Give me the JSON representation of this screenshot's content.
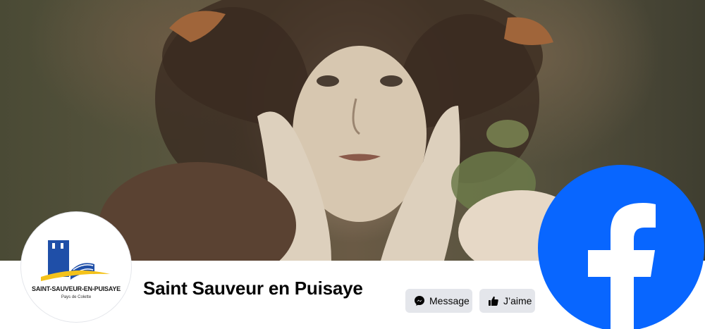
{
  "cover": {
    "icon": "cover-photo"
  },
  "profile": {
    "logo_name": "SAINT-SAUVEUR-EN-PUISAYE",
    "logo_sub": "Pays de Colette",
    "logo_colors": {
      "blue": "#1f4fa8",
      "yellow": "#f4c21a"
    }
  },
  "page": {
    "name": "Saint Sauveur en Puisaye"
  },
  "actions": {
    "message_label": "Message",
    "message_icon": "messenger-icon",
    "like_label": "J’aime",
    "like_icon": "thumbs-up-icon"
  },
  "brand": {
    "icon": "facebook-logo-icon",
    "color": "#0866ff"
  }
}
